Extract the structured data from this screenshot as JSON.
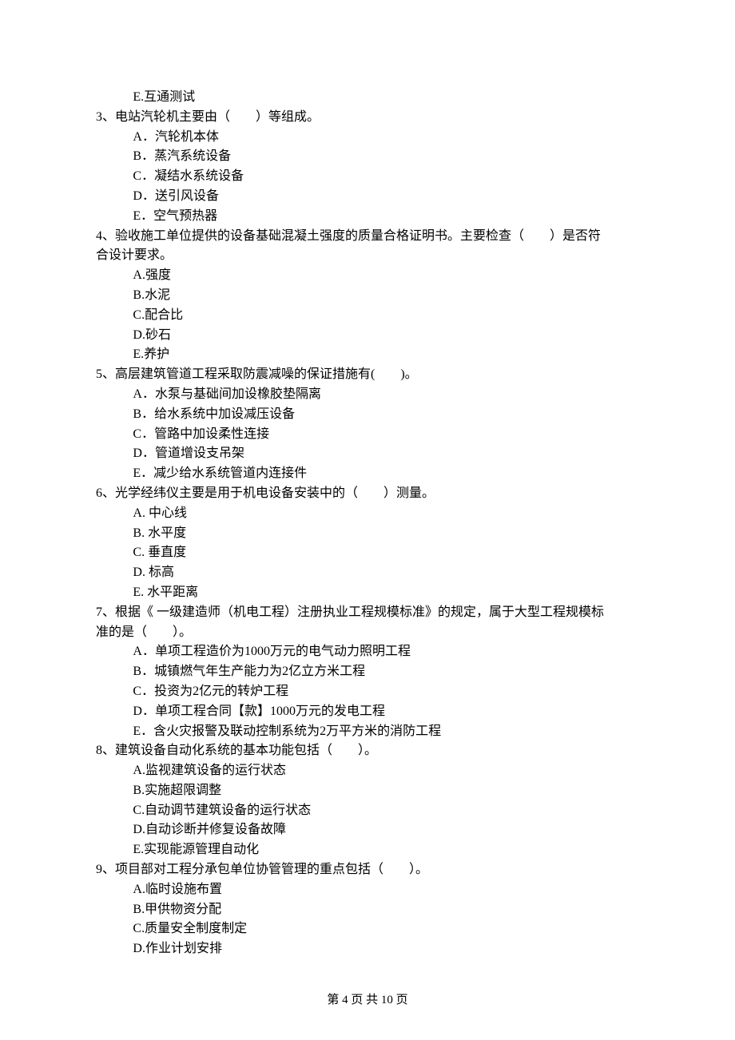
{
  "orphan_option": "E.互通测试",
  "questions": [
    {
      "num": "3、",
      "stem_lines": [
        "电站汽轮机主要由（　　）等组成。"
      ],
      "options": [
        "A．汽轮机本体",
        "B．蒸汽系统设备",
        "C．凝结水系统设备",
        "D．送引风设备",
        "E．空气预热器"
      ]
    },
    {
      "num": "4、",
      "stem_lines": [
        "验收施工单位提供的设备基础混凝土强度的质量合格证明书。主要检查（　　）是否符",
        "合设计要求。"
      ],
      "options": [
        "A.强度",
        "B.水泥",
        "C.配合比",
        "D.砂石",
        "E.养护"
      ]
    },
    {
      "num": "5、",
      "stem_lines": [
        "高层建筑管道工程采取防震减噪的保证措施有(　　)。"
      ],
      "options": [
        "A．水泵与基础间加设橡胶垫隔离",
        "B．给水系统中加设减压设备",
        "C．管路中加设柔性连接",
        "D．管道增设支吊架",
        "E．减少给水系统管道内连接件"
      ]
    },
    {
      "num": "6、",
      "stem_lines": [
        "光学经纬仪主要是用于机电设备安装中的（　　）测量。"
      ],
      "options": [
        "A. 中心线",
        "B. 水平度",
        "C. 垂直度",
        "D. 标高",
        "E. 水平距离"
      ]
    },
    {
      "num": "7、",
      "stem_lines": [
        "根据《 一级建造师（机电工程）注册执业工程规模标准》的规定，属于大型工程规模标",
        "准的是（　　）。"
      ],
      "options": [
        "A．单项工程造价为1000万元的电气动力照明工程",
        "B．城镇燃气年生产能力为2亿立方米工程",
        "C．投资为2亿元的转炉工程",
        "D．单项工程合同【款】1000万元的发电工程",
        "E．含火灾报警及联动控制系统为2万平方米的消防工程"
      ]
    },
    {
      "num": "8、",
      "stem_lines": [
        "建筑设备自动化系统的基本功能包括（　　）。"
      ],
      "options": [
        "A.监视建筑设备的运行状态",
        "B.实施超限调整",
        "C.自动调节建筑设备的运行状态",
        "D.自动诊断并修复设备故障",
        "E.实现能源管理自动化"
      ]
    },
    {
      "num": "9、",
      "stem_lines": [
        "项目部对工程分承包单位协管管理的重点包括（　　）。"
      ],
      "options": [
        "A.临时设施布置",
        "B.甲供物资分配",
        "C.质量安全制度制定",
        "D.作业计划安排"
      ]
    }
  ],
  "footer": "第 4 页 共 10 页"
}
